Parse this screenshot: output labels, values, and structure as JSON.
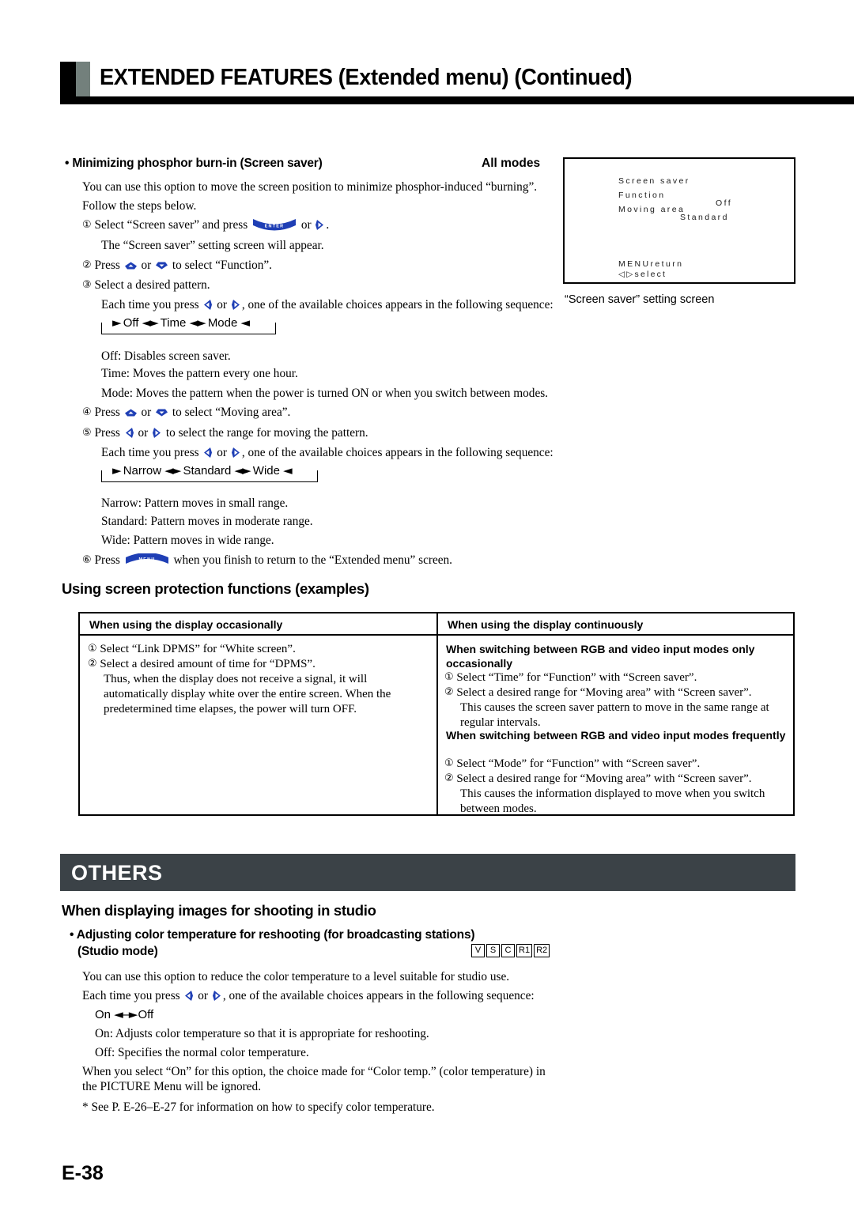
{
  "page": {
    "title": "EXTENDED FEATURES (Extended menu) (Continued)",
    "number": "E-38"
  },
  "section1": {
    "bullet_heading": "• Minimizing phosphor burn-in (Screen saver)",
    "modes_label": "All modes",
    "intro1": "You can use this option to move the screen position to minimize phosphor-induced “burning”.",
    "intro2": "Follow the steps below.",
    "steps": {
      "s1_num": "①",
      "s1_a": "Select “Screen saver” and press",
      "s1_b": "or",
      "s1_c": ".",
      "s1_note": "The “Screen saver” setting screen will appear.",
      "s2_num": "②",
      "s2_a": "Press",
      "s2_b": "or",
      "s2_c": "to select “Function”.",
      "s3_num": "③",
      "s3_a": "Select a desired pattern.",
      "s3_each": "Each time you press",
      "s3_each2": "or",
      "s3_each3": ", one of the available choices appears in the following sequence:",
      "s4_num": "④",
      "s4_a": "Press",
      "s4_b": "or",
      "s4_c": "to select “Moving area”.",
      "s5_num": "⑤",
      "s5_a": "Press",
      "s5_b": "or",
      "s5_c": "to select the range for moving the pattern.",
      "s6_num": "⑥",
      "s6_a": "Press",
      "s6_b": "when you finish to return to the “Extended menu” screen."
    },
    "sequence_function": {
      "opt1": "Off",
      "opt2": "Time",
      "opt3": "Mode"
    },
    "sequence_moving": {
      "opt1": "Narrow",
      "opt2": "Standard",
      "opt3": "Wide"
    },
    "defs_function": [
      "Off: Disables screen saver.",
      "Time: Moves the pattern every one hour.",
      "Mode: Moves the pattern when the power is turned ON or when you switch between modes."
    ],
    "defs_moving": [
      "Narrow: Pattern moves in small range.",
      "Standard: Pattern moves in moderate range.",
      "Wide: Pattern moves in wide range."
    ]
  },
  "osd": {
    "title": "Screen saver",
    "row1_label": "Function",
    "row1_value": "Off",
    "row2_label": "Moving area",
    "row2_value": "Standard",
    "footer1": "MENUreturn",
    "footer2": "◁▷select",
    "caption": "“Screen saver” setting screen"
  },
  "examples": {
    "heading": "Using screen protection functions (examples)",
    "col_left_header": "When using the display occasionally",
    "col_right_header": "When using the display continuously",
    "left_steps": [
      {
        "num": "①",
        "text": "Select “Link DPMS” for “White screen”."
      },
      {
        "num": "②",
        "text": "Select a desired amount of time for “DPMS”."
      }
    ],
    "left_note": "Thus, when the display does not receive a signal, it will automatically display white over the entire screen.  When the predetermined time elapses, the power will turn OFF.",
    "right_block1_title": "When switching between RGB and video input modes only occasionally",
    "right_block1_steps": [
      {
        "num": "①",
        "text": "Select “Time” for “Function” with “Screen saver”."
      },
      {
        "num": "②",
        "text": "Select a desired range for “Moving area” with “Screen saver”."
      }
    ],
    "right_block1_note": "This causes the screen saver pattern to move in the same range at regular intervals.",
    "right_block2_title": "When switching between RGB and video input modes frequently",
    "right_block2_steps": [
      {
        "num": "①",
        "text": "Select “Mode” for “Function” with “Screen saver”."
      },
      {
        "num": "②",
        "text": "Select a desired range for “Moving area” with “Screen saver”."
      }
    ],
    "right_block2_note": "This causes the information displayed to move when you switch between modes."
  },
  "others": {
    "bar_label": "OTHERS",
    "heading": "When displaying images for shooting in studio",
    "bullet_line1": "• Adjusting color temperature for reshooting (for broadcasting stations)",
    "bullet_line2": "(Studio mode)",
    "badges": [
      "V",
      "S",
      "C",
      "R1",
      "R2"
    ],
    "p1": "You can use this option to reduce the color temperature to a level suitable for studio use.",
    "p2_a": "Each time you press",
    "p2_b": "or",
    "p2_c": ", one of the available choices appears in the following sequence:",
    "seq_on": "On",
    "seq_off": "Off",
    "def_on": "On: Adjusts color temperature so that it is appropriate for reshooting.",
    "def_off": "Off: Specifies the normal color temperature.",
    "p3": "When you select “On” for this option, the choice made for “Color temp.” (color temperature) in the PICTURE Menu will be ignored.",
    "footnote": "* See P. E-26–E-27 for information on how to specify color temperature."
  },
  "colors": {
    "title_black": "#000000",
    "title_gray": "#73807c",
    "others_bar": "#3b4247",
    "button_blue": "#1f3fb5"
  }
}
